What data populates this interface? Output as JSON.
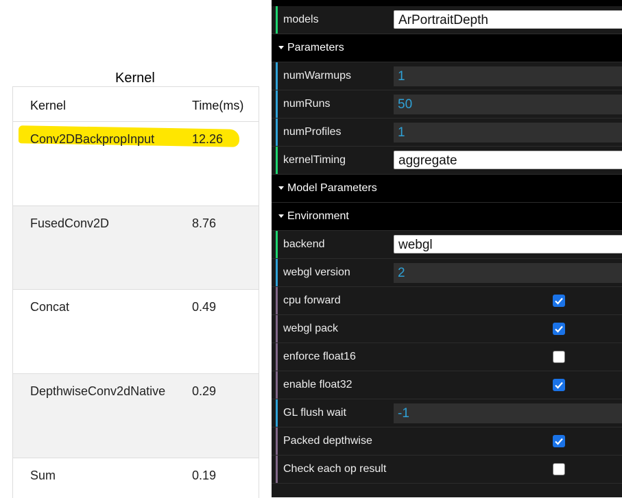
{
  "kernel_panel": {
    "title": "Kernel",
    "headers": [
      "Kernel",
      "Time(ms)"
    ],
    "rows": [
      {
        "kernel": "Conv2DBackpropInput",
        "time": "12.26"
      },
      {
        "kernel": "FusedConv2D",
        "time": "8.76"
      },
      {
        "kernel": "Concat",
        "time": "0.49"
      },
      {
        "kernel": "DepthwiseConv2dNative",
        "time": "0.29"
      },
      {
        "kernel": "Sum",
        "time": "0.19"
      }
    ],
    "highlight_color": "#ffe600"
  },
  "gui": {
    "models": {
      "label": "models",
      "value": "ArPortraitDepth"
    },
    "parameters_folder": "Parameters",
    "numWarmups": {
      "label": "numWarmups",
      "value": "1"
    },
    "numRuns": {
      "label": "numRuns",
      "value": "50"
    },
    "numProfiles": {
      "label": "numProfiles",
      "value": "1"
    },
    "kernelTiming": {
      "label": "kernelTiming",
      "value": "aggregate"
    },
    "model_parameters_folder": "Model Parameters",
    "environment_folder": "Environment",
    "backend": {
      "label": "backend",
      "value": "webgl"
    },
    "webgl_version": {
      "label": "webgl version",
      "value": "2"
    },
    "cpu_forward": {
      "label": "cpu forward",
      "checked": true
    },
    "webgl_pack": {
      "label": "webgl pack",
      "checked": true
    },
    "enforce_float16": {
      "label": "enforce float16",
      "checked": false
    },
    "enable_float32": {
      "label": "enable float32",
      "checked": true
    },
    "gl_flush_wait": {
      "label": "GL flush wait",
      "value": "-1"
    },
    "packed_depthwise": {
      "label": "Packed depthwise",
      "checked": true
    },
    "check_each_op": {
      "label": "Check each op result",
      "checked": false
    },
    "colors": {
      "select_edge": "#1ed36f",
      "number_edge": "#2fa1d6",
      "boolean_edge": "#806787",
      "accent": "#1a73e8"
    }
  }
}
